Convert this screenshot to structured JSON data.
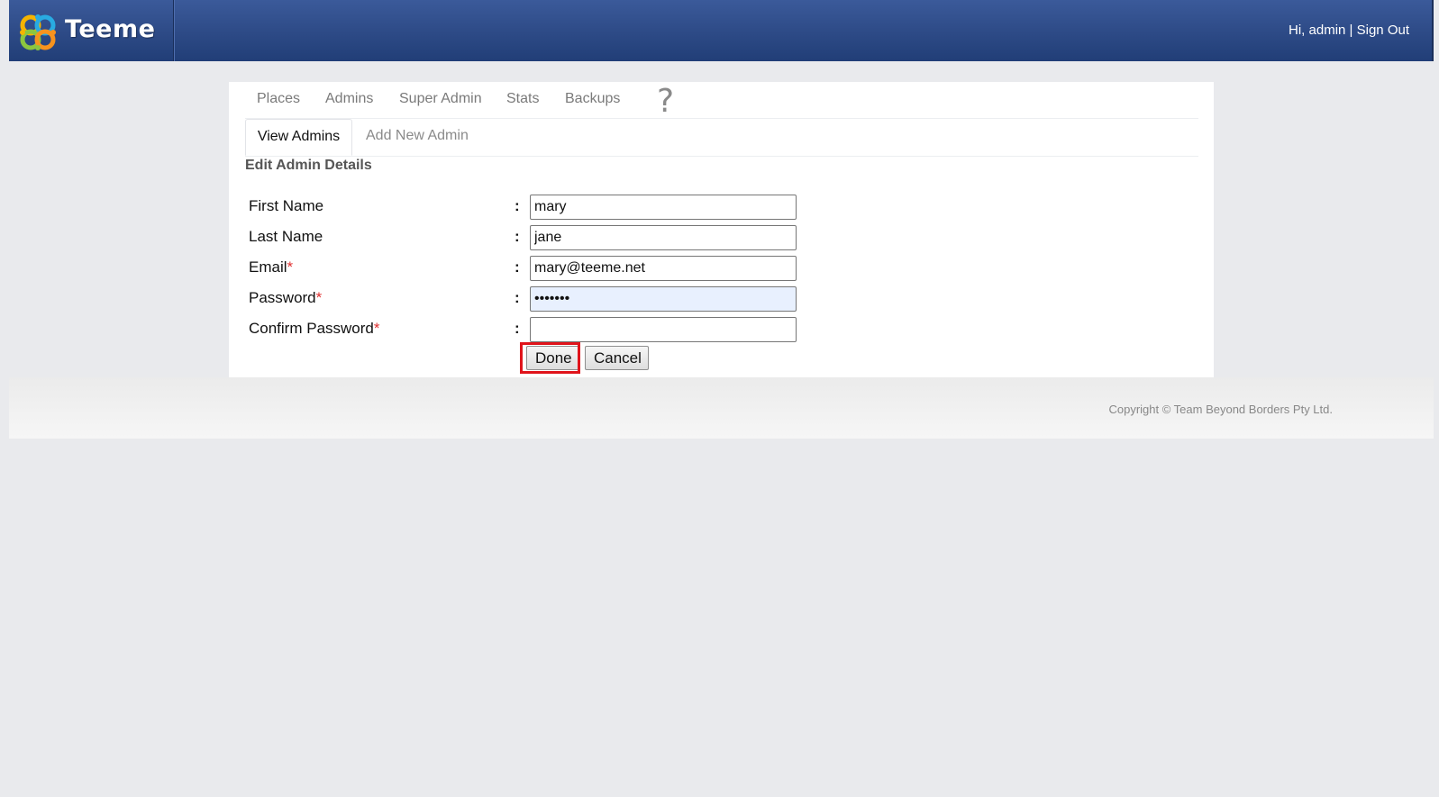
{
  "header": {
    "logo_text": "Teeme",
    "greeting": "Hi, admin",
    "separator": "|",
    "sign_out": "Sign Out"
  },
  "main_nav": {
    "items": [
      {
        "label": "Places"
      },
      {
        "label": "Admins"
      },
      {
        "label": "Super Admin"
      },
      {
        "label": "Stats"
      },
      {
        "label": "Backups"
      }
    ],
    "help_glyph": "?"
  },
  "sub_nav": {
    "tabs": [
      {
        "label": "View Admins",
        "active": true
      },
      {
        "label": "Add New Admin",
        "active": false
      }
    ]
  },
  "form": {
    "title": "Edit Admin Details",
    "colon": ":",
    "required_mark": "*",
    "fields": [
      {
        "label": "First Name",
        "required": false,
        "value": "mary",
        "type": "text"
      },
      {
        "label": "Last Name",
        "required": false,
        "value": "jane",
        "type": "text"
      },
      {
        "label": "Email",
        "required": true,
        "value": "mary@teeme.net",
        "type": "text"
      },
      {
        "label": "Password",
        "required": true,
        "value": "1234567",
        "type": "password"
      },
      {
        "label": "Confirm Password",
        "required": true,
        "value": "",
        "type": "password"
      }
    ],
    "done_label": "Done",
    "cancel_label": "Cancel"
  },
  "footer": {
    "copyright": "Copyright © Team Beyond Borders Pty Ltd."
  },
  "colors": {
    "header_blue": "#2d4a86",
    "highlight_red": "#e0141b",
    "required_red": "#e03030",
    "autofill_bg": "#e8f0fe"
  }
}
